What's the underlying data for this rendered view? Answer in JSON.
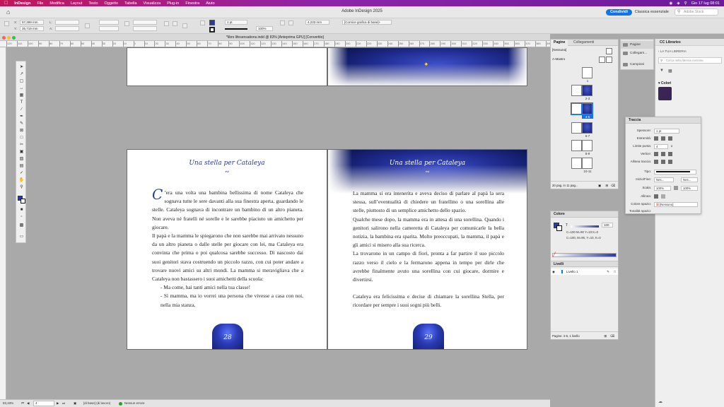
{
  "menubar": {
    "app": "InDesign",
    "items": [
      "File",
      "Modifica",
      "Layout",
      "Testo",
      "Oggetto",
      "Tabella",
      "Visualizza",
      "Plug-in",
      "Finestra",
      "Aiuto"
    ],
    "clock": "Gio 17 lug 08:01"
  },
  "appbar": {
    "title": "Adobe InDesign 2025",
    "share": "Condividi",
    "workspace": "Classica essenziale",
    "search_placeholder": "Adobe Stock"
  },
  "control": {
    "x_label": "X:",
    "x_value": "57,399 mm",
    "y_label": "Y:",
    "y_value": "35,719 mm",
    "l_label": "L:",
    "h_label": "A:",
    "stroke_weight": "1 pt",
    "zoom": "100%",
    "width_value": "4,233 mm",
    "style": "[Cornice grafica di base]+"
  },
  "document": {
    "tab_title": "*libro lifesensations.indd @ 83% [Anteprima GPU] [Convertito]"
  },
  "ruler": {
    "ticks": [
      "120",
      "110",
      "100",
      "90",
      "80",
      "70",
      "60",
      "50",
      "40",
      "30",
      "20",
      "10",
      "0",
      "10",
      "20",
      "30",
      "40",
      "50",
      "60",
      "70",
      "80",
      "90",
      "100",
      "110",
      "120",
      "130",
      "140",
      "150",
      "160",
      "170",
      "180",
      "190",
      "200",
      "210",
      "220",
      "230",
      "240",
      "250",
      "260",
      "270",
      "280",
      "290",
      "300",
      "310",
      "320",
      "330",
      "340",
      "350",
      "360",
      "370",
      "380",
      "390"
    ]
  },
  "left_page": {
    "title": "Una stella per Cataleya",
    "dropcap": "C",
    "paragraphs": [
      "’era una volta una bambina bellissima di nome Cataleya che sognava tutte le sere davanti alla sua finestra aperta, guardando le stelle. Cataleya sognava di incontrare un bambino di un altro pianeta. Non aveva né fratelli né sorelle e le sarebbe piaciuto un amichetto per giocare.",
      "Il papà e la mamma le spiegarono che non sarebbe mai arrivato nessuno da un altro pianeta o dalle stelle per giocare con lei, ma Cataleya era convinta che prima o poi qualcosa sarebbe successo. Di nascosto dai suoi genitori stava costruendo un piccolo razzo, con cui poter andare a trovare nuovi amici su altri mondi. La mamma si meravigliava che a Cataleya non bastassero i suoi amichetti della scuola:"
    ],
    "dialog": [
      "- Ma come, hai tanti amici nella tua classe!",
      "- Sì mamma, ma io vorrei una persona che vivesse a casa con noi, nella mia stanza."
    ],
    "page_number": "28"
  },
  "right_page": {
    "title": "Una stella per Cataleya",
    "paragraphs": [
      "La mamma si era intenerita e aveva deciso di parlare al papà la sera stessa, sull’eventualità di chiedere un fratellino o una sorellina alle stelle, piuttosto di un semplice amichetto dello spazio.",
      "Qualche mese dopo, la mamma era in attesa di una sorellina. Quando i genitori salirono nella cameretta di Cataleya per comunicarle la bella notizia, la bambina era sparita. Molto preoccupati, la mamma, il papà e gli amici si misero alla sua ricerca.",
      "La trovarono in un campo di fiori, pronta a far partire il suo piccolo razzo verso il cielo e la fermarono appena in tempo per dirle che avrebbe finalmente avuto una sorellina con cui giocare, dormire e divertirsi.",
      "",
      "Cataleya era felicissima e decise di chiamare la sorellina Stella, per ricordare per sempre i suoi sogni più belli."
    ],
    "page_number": "29"
  },
  "pages_panel": {
    "tabs": [
      "Pagine",
      "Collegamenti"
    ],
    "none_label": "[Nessuna]",
    "master_label": "A-Mastro",
    "spreads": [
      "1",
      "2-3",
      "4-5",
      "6-7",
      "8-9",
      "10-11"
    ],
    "footer": "20 pag. in 11 pag..."
  },
  "strip": {
    "items": [
      "Pagine",
      "Collegam...",
      "Campioni"
    ]
  },
  "libraries": {
    "title": "CC Libraries",
    "library": "LA TUA LIBRERIA",
    "search_placeholder": "Cerca nella libreria corrente",
    "section": "Colori",
    "swatch_color": "#3b2456"
  },
  "stroke_panel": {
    "title": "Traccia",
    "rows": [
      {
        "label": "Spessore:",
        "value": "1 pt"
      },
      {
        "label": "Estremità:",
        "value": ""
      },
      {
        "label": "Limite punta:",
        "value": "4"
      },
      {
        "label": "Vertice:",
        "value": ""
      },
      {
        "label": "Allinea traccia:",
        "value": ""
      },
      {
        "label": "Tipo:",
        "value": ""
      },
      {
        "label": "Inizio/Fine:",
        "value": "Nes..."
      },
      {
        "label": "Scala:",
        "value": "100%"
      },
      {
        "label": "Allinea:",
        "value": ""
      },
      {
        "label": "Colore spazio:",
        "value": "[Nessuno]"
      },
      {
        "label": "Tonalità spazio:",
        "value": ""
      }
    ],
    "end_value": "Nes...",
    "scale_value2": "100%",
    "limit_x": "x"
  },
  "color_panel": {
    "title": "Colore",
    "t_label": "T",
    "t_value": "100",
    "cmyk1": "C=100 M=90 Y=10 K=0",
    "cmyk2": "C=100, M=90, Y=10, K=0",
    "layers_title": "Livelli",
    "layer_name": "Livello 1",
    "footer": "Pagine: 4-5, 1 livello"
  },
  "status": {
    "zoom": "83,33%",
    "page": "4",
    "base": "[di base] (di lavoro)",
    "errors": "Nessun errore"
  }
}
